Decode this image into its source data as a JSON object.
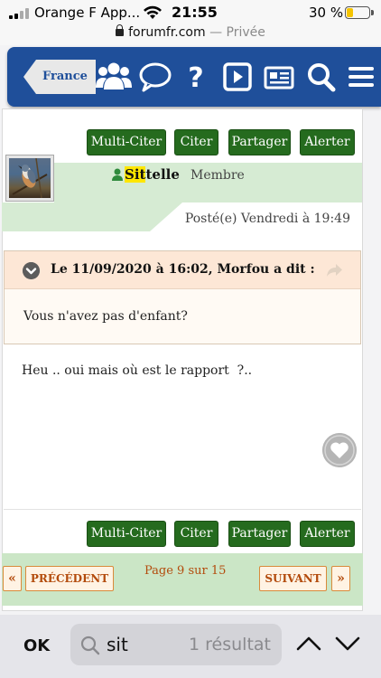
{
  "status_bar": {
    "carrier": "Orange F App...",
    "time": "21:55",
    "battery_percent": "30 %",
    "battery_level": 0.3
  },
  "url_bar": {
    "domain": "forumfr.com",
    "mode": "— Privée"
  },
  "header": {
    "back_label": "France",
    "icons": [
      "members-icon",
      "chat-bubble-icon",
      "help-icon",
      "video-play-icon",
      "news-icon",
      "search-icon",
      "menu-icon"
    ],
    "color": "#1f4f9a"
  },
  "post_actions": {
    "multi_quote": "Multi-Citer",
    "quote": "Citer",
    "share": "Partager",
    "report": "Alerter"
  },
  "post": {
    "author_match": "Sit",
    "author_rest": "telle",
    "role": "Membre",
    "posted": "Posté(e) Vendredi à 19:49",
    "quote_author": "Le 11/09/2020 à 16:02, Morfou a dit :",
    "quote_text": "Vous n'avez pas d'enfant?",
    "body": "Heu .. oui mais où est le rapport  ?.."
  },
  "pagination": {
    "first_symbol": "«",
    "prev_label": "PRÉCÉDENT",
    "page_info": "Page 9 sur 15",
    "next_label": "SUIVANT",
    "last_symbol": "»"
  },
  "find_bar": {
    "ok_label": "OK",
    "query": "sit",
    "result": "1 résultat"
  },
  "colors": {
    "action_green": "#256b1e",
    "highlight": "#ffe600",
    "pager_orange": "#b34b0c"
  }
}
